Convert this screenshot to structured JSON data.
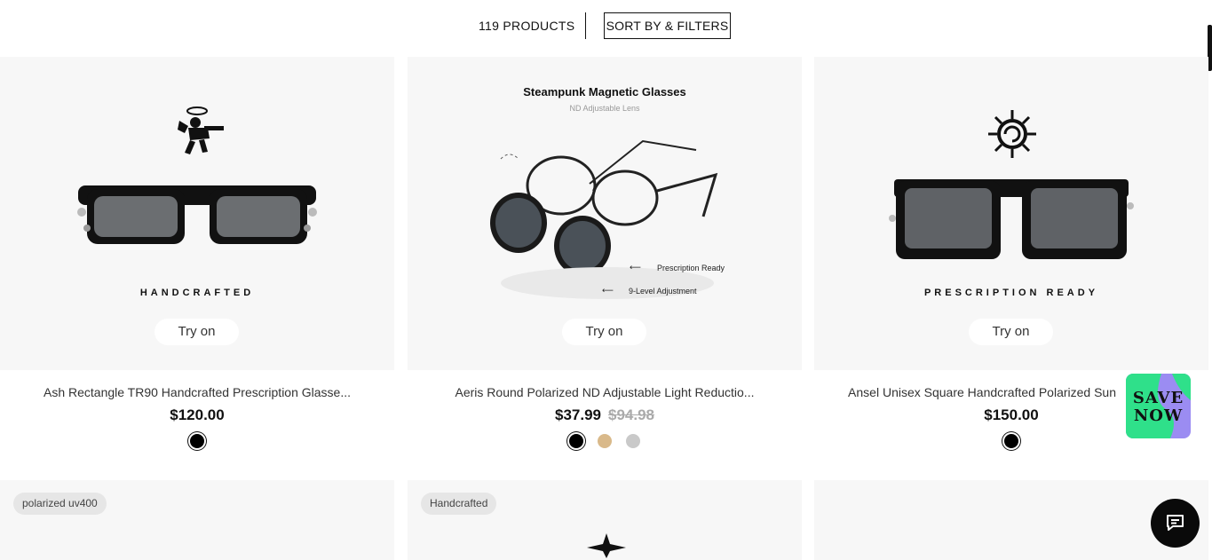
{
  "toolbar": {
    "count_label": "119 PRODUCTS",
    "sort_label": "SORT BY & FILTERS"
  },
  "products": [
    {
      "name": "Ash Rectangle TR90 Handcrafted Prescription Glasse...",
      "price": "$120.00",
      "tagline": "HANDCRAFTED",
      "tryon": "Try on",
      "swatches": [
        "#000000"
      ]
    },
    {
      "name": "Aeris Round Polarized ND Adjustable Light Reductio...",
      "price": "$37.99",
      "old_price": "$94.98",
      "image_title": "Steampunk Magnetic Glasses",
      "image_subtitle": "ND Adjustable Lens",
      "callout_1": "Prescription Ready",
      "callout_2": "9-Level Adjustment",
      "tryon": "Try on",
      "swatches": [
        "#000000",
        "#d9b98a",
        "#c9c9c9"
      ]
    },
    {
      "name": "Ansel Unisex Square Handcrafted Polarized Sun",
      "price": "$150.00",
      "tagline": "PRESCRIPTION READY",
      "tryon": "Try on",
      "swatches": [
        "#000000"
      ]
    }
  ],
  "row2": {
    "badge_1": "polarized uv400",
    "badge_2": "Handcrafted"
  },
  "promo": {
    "line1": "SAVE",
    "line2": "NOW",
    "colors": [
      "#9b8cf2",
      "#2fe08a"
    ]
  },
  "colors": {
    "card_bg": "#f7f7f7",
    "text_dark": "#111111",
    "old_price": "#aaaaaa"
  }
}
